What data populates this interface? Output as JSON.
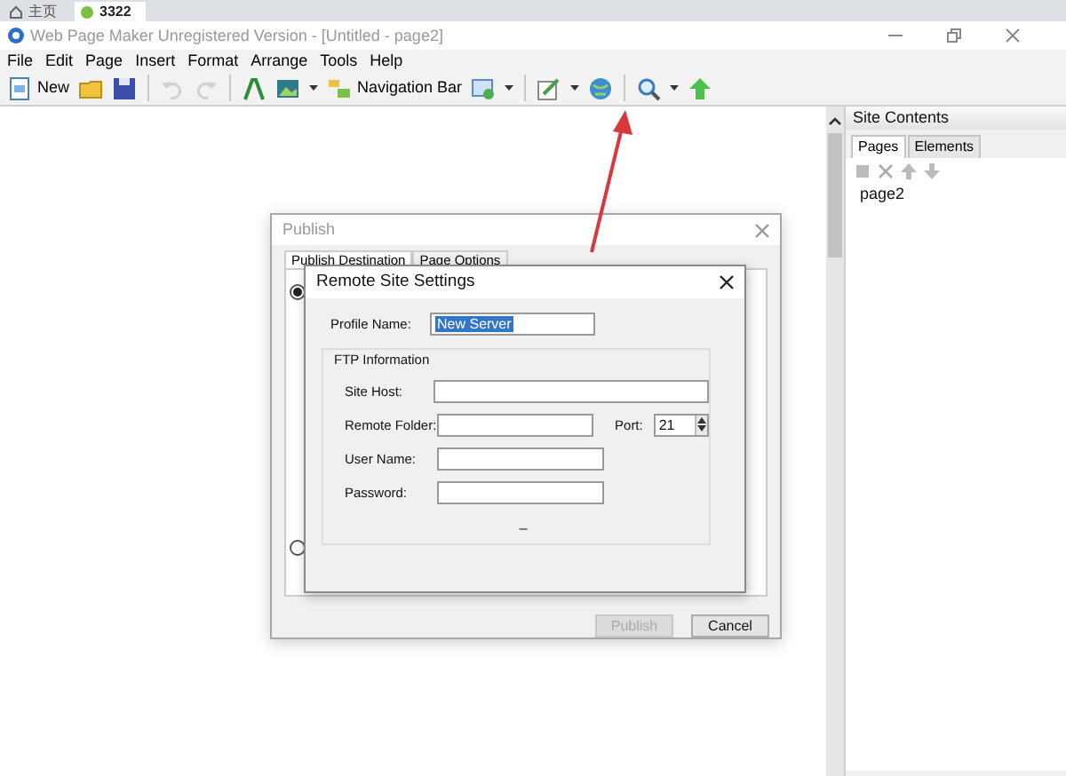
{
  "browser_tabs": [
    {
      "label": "主页",
      "selected": false
    },
    {
      "label": "3322",
      "selected": true
    }
  ],
  "window": {
    "title": "Web Page Maker Unregistered Version - [Untitled - page2]"
  },
  "menu": [
    "File",
    "Edit",
    "Page",
    "Insert",
    "Format",
    "Arrange",
    "Tools",
    "Help"
  ],
  "toolbar": [
    {
      "kind": "new",
      "label": "New"
    },
    {
      "kind": "open"
    },
    {
      "kind": "save"
    },
    {
      "kind": "separator"
    },
    {
      "kind": "undo",
      "disabled": true
    },
    {
      "kind": "redo",
      "disabled": true
    },
    {
      "kind": "separator"
    },
    {
      "kind": "text"
    },
    {
      "kind": "image",
      "has_menu": true
    },
    {
      "kind": "navbar",
      "label": "Navigation Bar"
    },
    {
      "kind": "form",
      "has_menu": true
    },
    {
      "kind": "separator"
    },
    {
      "kind": "pen",
      "has_menu": true
    },
    {
      "kind": "globe"
    },
    {
      "kind": "separator"
    },
    {
      "kind": "zoom",
      "has_menu": true
    },
    {
      "kind": "upload"
    }
  ],
  "site_panel": {
    "title": "Site Contents",
    "tabs": [
      {
        "label": "Pages",
        "selected": true
      },
      {
        "label": "Elements",
        "selected": false
      }
    ],
    "pages": [
      {
        "label": "page2"
      }
    ]
  },
  "publish_dialog": {
    "title": "Publish",
    "tabs": [
      {
        "label": "Publish Destination",
        "selected": true
      },
      {
        "label": "Page Options",
        "selected": false
      }
    ],
    "radios": [
      {
        "selected": true
      },
      {
        "selected": false
      }
    ],
    "buttons": [
      {
        "label": "Publish",
        "disabled": true
      },
      {
        "label": "Cancel",
        "disabled": false
      }
    ]
  },
  "remote_dialog": {
    "title": "Remote Site Settings",
    "profile": {
      "label": "Profile Name:",
      "value": "New Server",
      "selected": true
    },
    "group_title": "FTP Information",
    "fields": [
      {
        "kind": "wide",
        "label": "Site Host:"
      },
      {
        "kind": "port",
        "label": "Remote Folder:",
        "port_label": "Port:",
        "port_value": "21"
      },
      {
        "kind": "short",
        "label": "User Name:"
      },
      {
        "kind": "short",
        "label": "Password:"
      }
    ],
    "status_text": "–"
  }
}
